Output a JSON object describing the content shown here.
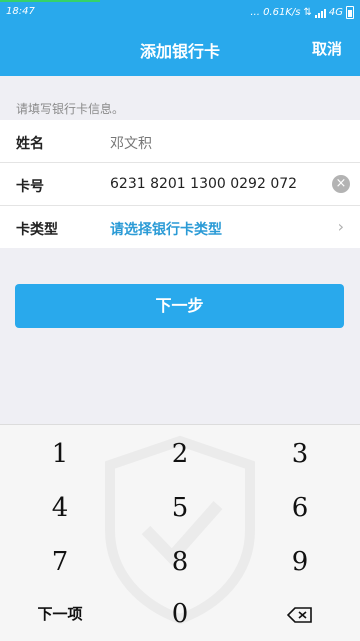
{
  "status_bar": {
    "time": "18:47",
    "network_info": "... 0.61K/s",
    "network_type": "4G",
    "icons": [
      "data-arrows-icon",
      "signal-icon",
      "battery-icon"
    ]
  },
  "nav": {
    "title": "添加银行卡",
    "cancel_label": "取消"
  },
  "form": {
    "hint": "请填写银行卡信息。",
    "rows": [
      {
        "label": "姓名",
        "value": "邓文积"
      },
      {
        "label": "卡号",
        "value": "6231 8201 1300 0292 072"
      },
      {
        "label": "卡类型",
        "value": "请选择银行卡类型"
      }
    ]
  },
  "next_button_label": "下一步",
  "keyboard": {
    "keys": [
      "1",
      "2",
      "3",
      "4",
      "5",
      "6",
      "7",
      "8",
      "9",
      "下一项",
      "0"
    ],
    "backspace_icon": "backspace-icon",
    "watermark_icon": "shield-check-icon"
  },
  "colors": {
    "accent": "#29a9ec",
    "link_blue": "#2b9bd6",
    "background": "#efeff4"
  }
}
